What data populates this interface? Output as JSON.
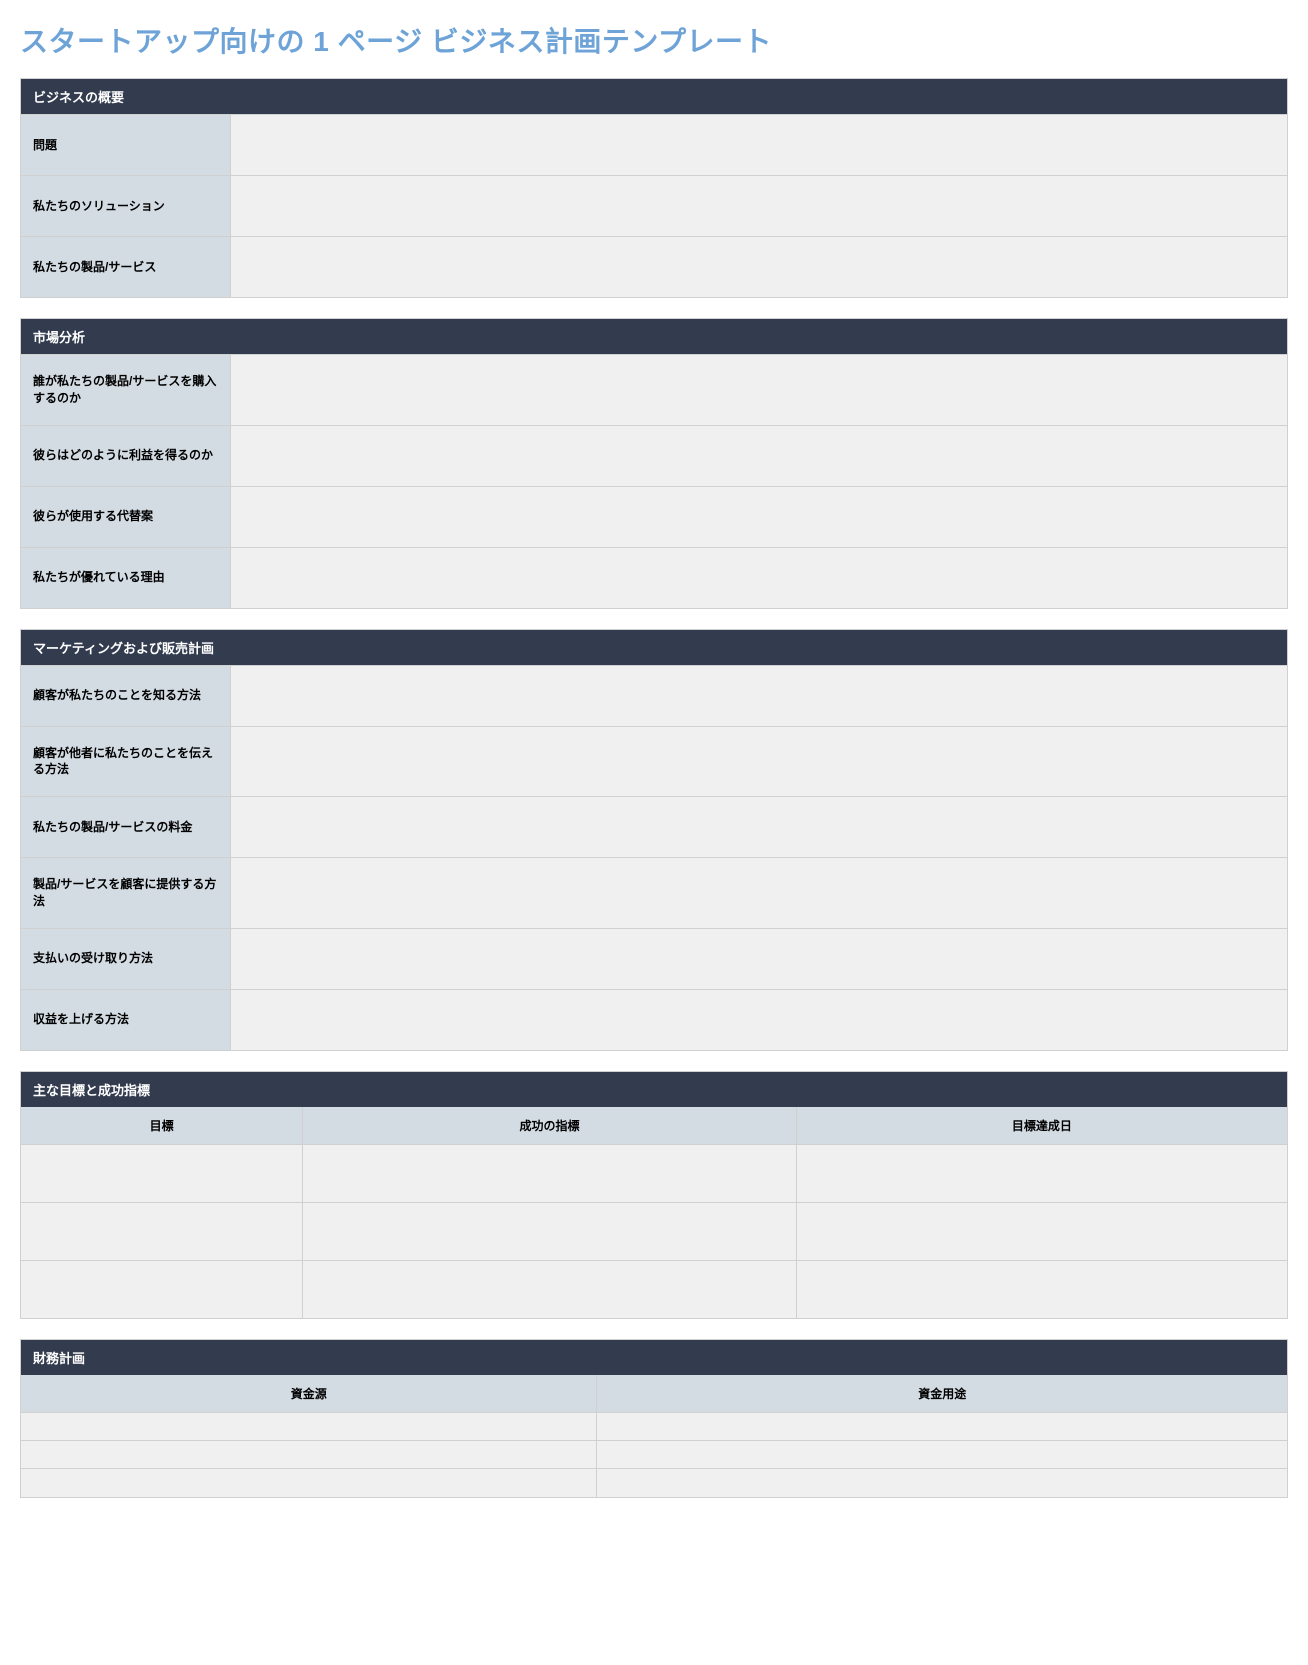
{
  "title": "スタートアップ向けの 1 ページ ビジネス計画テンプレート",
  "sections": {
    "overview": {
      "header": "ビジネスの概要",
      "rows": [
        {
          "label": "問題",
          "value": ""
        },
        {
          "label": "私たちのソリューション",
          "value": ""
        },
        {
          "label": "私たちの製品/サービス",
          "value": ""
        }
      ]
    },
    "market": {
      "header": "市場分析",
      "rows": [
        {
          "label": "誰が私たちの製品/サービスを購入するのか",
          "value": ""
        },
        {
          "label": "彼らはどのように利益を得るのか",
          "value": ""
        },
        {
          "label": "彼らが使用する代替案",
          "value": ""
        },
        {
          "label": "私たちが優れている理由",
          "value": ""
        }
      ]
    },
    "marketing": {
      "header": "マーケティングおよび販売計画",
      "rows": [
        {
          "label": "顧客が私たちのことを知る方法",
          "value": ""
        },
        {
          "label": "顧客が他者に私たちのことを伝える方法",
          "value": ""
        },
        {
          "label": "私たちの製品/サービスの料金",
          "value": ""
        },
        {
          "label": "製品/サービスを顧客に提供する方法",
          "value": ""
        },
        {
          "label": "支払いの受け取り方法",
          "value": ""
        },
        {
          "label": "収益を上げる方法",
          "value": ""
        }
      ]
    },
    "goals": {
      "header": "主な目標と成功指標",
      "columns": [
        "目標",
        "成功の指標",
        "目標達成日"
      ],
      "rows": [
        [
          "",
          "",
          ""
        ],
        [
          "",
          "",
          ""
        ],
        [
          "",
          "",
          ""
        ]
      ]
    },
    "finance": {
      "header": "財務計画",
      "columns": [
        "資金源",
        "資金用途"
      ],
      "rows": [
        [
          "",
          ""
        ],
        [
          "",
          ""
        ],
        [
          "",
          ""
        ]
      ]
    }
  }
}
